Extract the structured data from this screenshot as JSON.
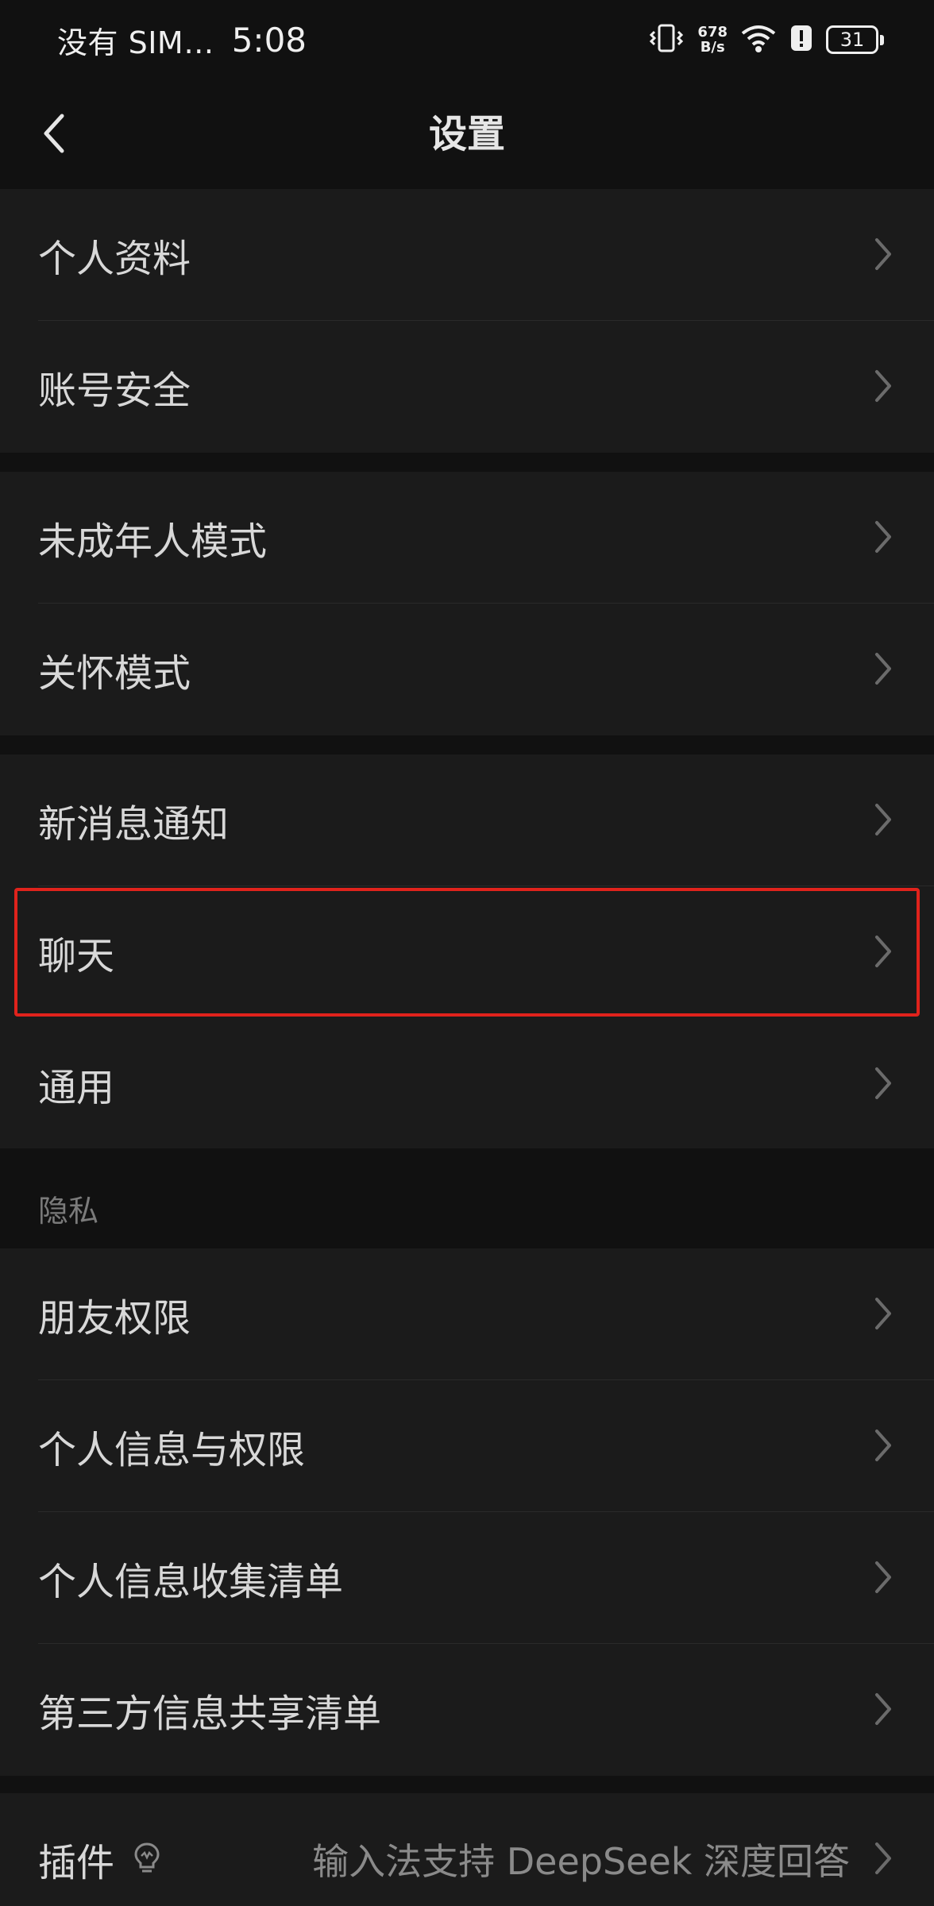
{
  "status_bar": {
    "carrier": "没有 SIM…",
    "time": "5:08",
    "net_speed_value": "678",
    "net_speed_unit": "B/s",
    "battery": "31"
  },
  "nav": {
    "title": "设置",
    "back_icon": "chevron-left-icon"
  },
  "groups": {
    "g1": [
      "个人资料",
      "账号安全"
    ],
    "g2": [
      "未成年人模式",
      "关怀模式"
    ],
    "g3": [
      "新消息通知",
      "聊天",
      "通用"
    ],
    "g4": [
      "朋友权限",
      "个人信息与权限",
      "个人信息收集清单",
      "第三方信息共享清单"
    ]
  },
  "privacy_header": "隐私",
  "plugin": {
    "label": "插件",
    "hint": "输入法支持 DeepSeek 深度回答"
  },
  "colors": {
    "background": "#111111",
    "card": "#1b1b1b",
    "highlight": "#e0231c",
    "text": "#d8d8d8",
    "muted": "#8a8a8a"
  }
}
